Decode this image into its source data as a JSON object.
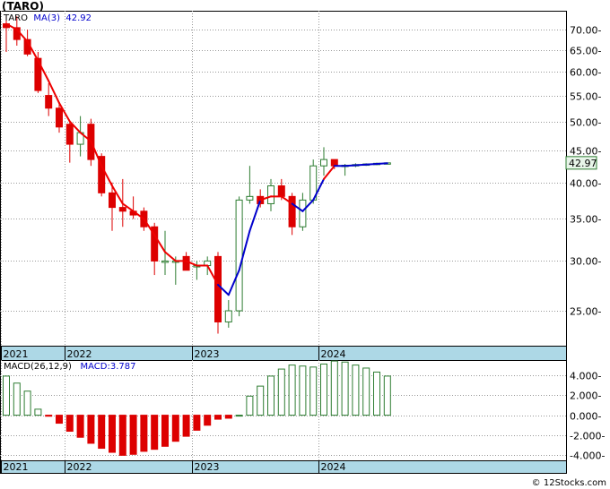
{
  "title": "(TARO)",
  "credit": "© 12Stocks.com",
  "price_panel": {
    "legend_ticker": "TARO",
    "legend_ma_label": "MA(3)",
    "legend_ma_value": "42.92",
    "last_price_label": "42.97",
    "colors": {
      "up": "#2e7d32",
      "down": "#dd0000",
      "ma_down": "#ee0000",
      "ma_up": "#0000cc"
    }
  },
  "macd_panel": {
    "legend_label": "MACD(26,12,9)",
    "legend_value_label": "MACD:3.787",
    "colors": {
      "positive": "#2e7d32",
      "negative": "#dd0000"
    }
  },
  "chart_data": [
    {
      "type": "candlestick",
      "ylim": [
        22,
        75
      ],
      "scale": "log",
      "grid": true,
      "yticks": [
        25,
        30,
        35,
        40,
        45,
        50,
        55,
        60,
        65,
        70
      ],
      "ytick_labels": [
        "25.00-",
        "30.00-",
        "35.00-",
        "40.00-",
        "45.00-",
        "50.00-",
        "55.00-",
        "60.00-",
        "65.00-",
        "70.00-"
      ],
      "xtick_labels": [
        {
          "label": "2021",
          "index": 0
        },
        {
          "label": "2022",
          "index": 6
        },
        {
          "label": "2023",
          "index": 18
        },
        {
          "label": "2024",
          "index": 30
        }
      ],
      "candles": [
        {
          "o": 71.5,
          "h": 73.5,
          "l": 64.5,
          "c": 70.5
        },
        {
          "o": 70.5,
          "h": 73.5,
          "l": 66.0,
          "c": 67.5
        },
        {
          "o": 67.5,
          "h": 70.0,
          "l": 63.5,
          "c": 64.0
        },
        {
          "o": 63.0,
          "h": 64.5,
          "l": 55.5,
          "c": 56.0
        },
        {
          "o": 55.0,
          "h": 57.5,
          "l": 51.0,
          "c": 52.5
        },
        {
          "o": 52.5,
          "h": 53.5,
          "l": 48.0,
          "c": 49.0
        },
        {
          "o": 49.5,
          "h": 50.0,
          "l": 43.0,
          "c": 46.0
        },
        {
          "o": 46.0,
          "h": 51.0,
          "l": 44.0,
          "c": 48.0
        },
        {
          "o": 49.5,
          "h": 50.5,
          "l": 42.5,
          "c": 43.5
        },
        {
          "o": 44.0,
          "h": 44.5,
          "l": 38.0,
          "c": 38.5
        },
        {
          "o": 38.5,
          "h": 40.0,
          "l": 33.5,
          "c": 36.5
        },
        {
          "o": 36.5,
          "h": 40.5,
          "l": 34.0,
          "c": 36.0
        },
        {
          "o": 36.0,
          "h": 38.0,
          "l": 35.0,
          "c": 35.5
        },
        {
          "o": 36.0,
          "h": 36.5,
          "l": 33.5,
          "c": 34.0
        },
        {
          "o": 34.0,
          "h": 34.5,
          "l": 28.5,
          "c": 30.0
        },
        {
          "o": 30.0,
          "h": 33.5,
          "l": 28.5,
          "c": 30.0
        },
        {
          "o": 30.0,
          "h": 30.5,
          "l": 27.5,
          "c": 30.0
        },
        {
          "o": 30.5,
          "h": 31.0,
          "l": 29.0,
          "c": 29.0
        },
        {
          "o": 29.5,
          "h": 30.0,
          "l": 28.0,
          "c": 29.5
        },
        {
          "o": 29.5,
          "h": 30.5,
          "l": 28.5,
          "c": 30.0
        },
        {
          "o": 30.5,
          "h": 31.0,
          "l": 23.0,
          "c": 24.0
        },
        {
          "o": 24.0,
          "h": 26.0,
          "l": 23.5,
          "c": 25.0
        },
        {
          "o": 25.0,
          "h": 38.0,
          "l": 24.5,
          "c": 37.5
        },
        {
          "o": 37.5,
          "h": 42.5,
          "l": 37.0,
          "c": 38.0
        },
        {
          "o": 38.0,
          "h": 39.0,
          "l": 36.5,
          "c": 37.0
        },
        {
          "o": 37.0,
          "h": 40.5,
          "l": 36.0,
          "c": 39.5
        },
        {
          "o": 39.5,
          "h": 40.5,
          "l": 37.5,
          "c": 38.0
        },
        {
          "o": 38.0,
          "h": 38.5,
          "l": 33.0,
          "c": 34.0
        },
        {
          "o": 34.0,
          "h": 38.5,
          "l": 33.5,
          "c": 37.5
        },
        {
          "o": 37.5,
          "h": 43.5,
          "l": 37.0,
          "c": 42.5
        },
        {
          "o": 42.5,
          "h": 45.5,
          "l": 41.0,
          "c": 43.5
        },
        {
          "o": 43.5,
          "h": 43.5,
          "l": 42.0,
          "c": 42.5
        },
        {
          "o": 42.5,
          "h": 42.8,
          "l": 41.0,
          "c": 42.6
        },
        {
          "o": 42.6,
          "h": 42.9,
          "l": 42.3,
          "c": 42.7
        },
        {
          "o": 42.7,
          "h": 42.9,
          "l": 42.5,
          "c": 42.8
        },
        {
          "o": 42.8,
          "h": 43.0,
          "l": 42.6,
          "c": 42.9
        },
        {
          "o": 42.9,
          "h": 43.0,
          "l": 42.8,
          "c": 42.97
        }
      ],
      "ma": [
        71.5,
        70.0,
        67.0,
        62.5,
        58.0,
        53.5,
        50.0,
        48.0,
        46.5,
        42.5,
        39.5,
        37.0,
        36.0,
        35.0,
        33.0,
        31.0,
        30.0,
        30.0,
        29.5,
        29.5,
        27.5,
        26.5,
        29.0,
        33.5,
        37.5,
        38.0,
        38.0,
        37.0,
        36.0,
        37.5,
        40.5,
        42.5,
        42.5,
        42.6,
        42.7,
        42.8,
        42.92
      ],
      "ma_colors": [
        "r",
        "r",
        "r",
        "r",
        "r",
        "r",
        "r",
        "r",
        "r",
        "r",
        "r",
        "r",
        "r",
        "r",
        "r",
        "r",
        "r",
        "r",
        "r",
        "r",
        "r",
        "b",
        "b",
        "b",
        "b",
        "r",
        "r",
        "r",
        "b",
        "b",
        "b",
        "r",
        "b",
        "b",
        "b",
        "b",
        "b"
      ]
    },
    {
      "type": "bar",
      "ylim": [
        -4.5,
        5.5
      ],
      "yticks": [
        -4,
        -2,
        0,
        2,
        4
      ],
      "ytick_labels": [
        "-4.000-",
        "-2.000-",
        "0.000-",
        "2.000-",
        "4.000-"
      ],
      "xtick_labels": [
        {
          "label": "2021",
          "index": 0
        },
        {
          "label": "2022",
          "index": 6
        },
        {
          "label": "2023",
          "index": 18
        },
        {
          "label": "2024",
          "index": 30
        }
      ],
      "values": [
        3.9,
        3.2,
        2.4,
        0.6,
        -0.1,
        -0.8,
        -1.6,
        -2.2,
        -2.8,
        -3.3,
        -3.7,
        -4.0,
        -3.9,
        -3.6,
        -3.4,
        -3.1,
        -2.6,
        -2.1,
        -1.5,
        -1.0,
        -0.4,
        -0.3,
        0.0,
        1.9,
        2.9,
        3.9,
        4.6,
        5.0,
        4.9,
        4.8,
        5.1,
        5.4,
        5.3,
        5.0,
        4.7,
        4.3,
        3.9
      ]
    }
  ]
}
